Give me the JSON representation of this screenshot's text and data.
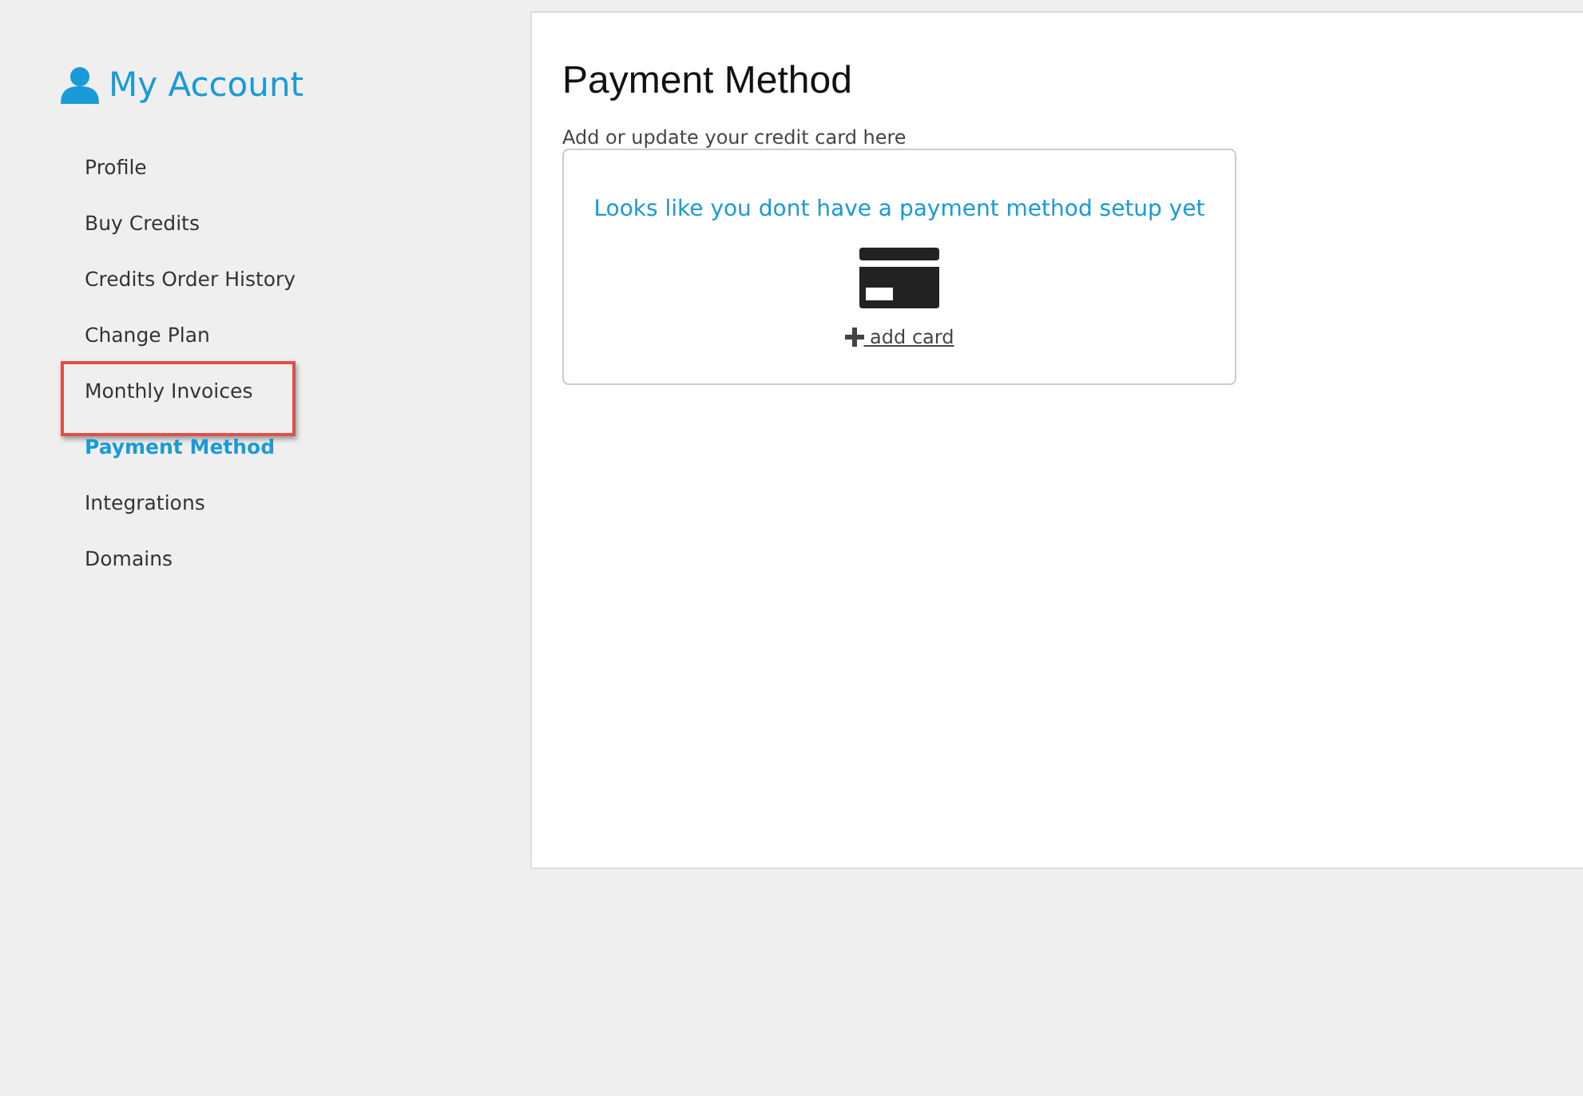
{
  "sidebar": {
    "title": "My Account",
    "items": [
      {
        "label": "Profile",
        "selected": false,
        "highlighted": false
      },
      {
        "label": "Buy Credits",
        "selected": false,
        "highlighted": false
      },
      {
        "label": "Credits Order History",
        "selected": false,
        "highlighted": false
      },
      {
        "label": "Change Plan",
        "selected": false,
        "highlighted": false
      },
      {
        "label": "Monthly Invoices",
        "selected": false,
        "highlighted": true
      },
      {
        "label": "Payment Method",
        "selected": true,
        "highlighted": false
      },
      {
        "label": "Integrations",
        "selected": false,
        "highlighted": false
      },
      {
        "label": "Domains",
        "selected": false,
        "highlighted": false
      }
    ]
  },
  "main": {
    "title": "Payment Method",
    "subtitle": "Add or update your credit card here",
    "card": {
      "message": "Looks like you dont have a payment method setup yet",
      "link": " add card"
    }
  }
}
